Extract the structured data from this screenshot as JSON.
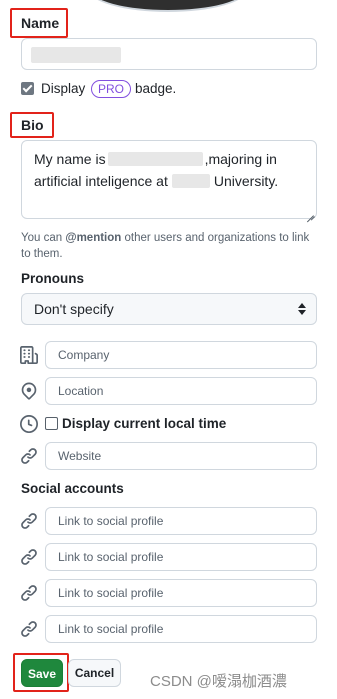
{
  "profile": {
    "name_label": "Name",
    "display_label": "Display",
    "pro_badge": "PRO",
    "badge_label": "badge.",
    "bio_label": "Bio",
    "bio_line1_prefix": "My name is",
    "bio_line1_suffix": ",majoring in",
    "bio_line2_prefix": "artificial inteligence at",
    "bio_line2_suffix": "University.",
    "mention_hint_prefix": "You can",
    "mention_hint_keyword": "@mention",
    "mention_hint_suffix": "other users and organizations to link to them.",
    "pronouns_label": "Pronouns",
    "pronouns_value": "Don't specify",
    "company_placeholder": "Company",
    "location_placeholder": "Location",
    "local_time_label": "Display current local time",
    "website_placeholder": "Website",
    "social_label": "Social accounts",
    "social_placeholders": [
      "Link to social profile",
      "Link to social profile",
      "Link to social profile",
      "Link to social profile"
    ]
  },
  "actions": {
    "save_label": "Save",
    "cancel_label": "Cancel"
  },
  "watermark": "CSDN @嗳溻枷酒濃",
  "colors": {
    "highlight": "#e2231a",
    "save_green": "#1f883d",
    "pro_purple": "#8250df"
  },
  "icons": [
    "company-icon",
    "location-icon",
    "clock-icon",
    "link-icon"
  ]
}
